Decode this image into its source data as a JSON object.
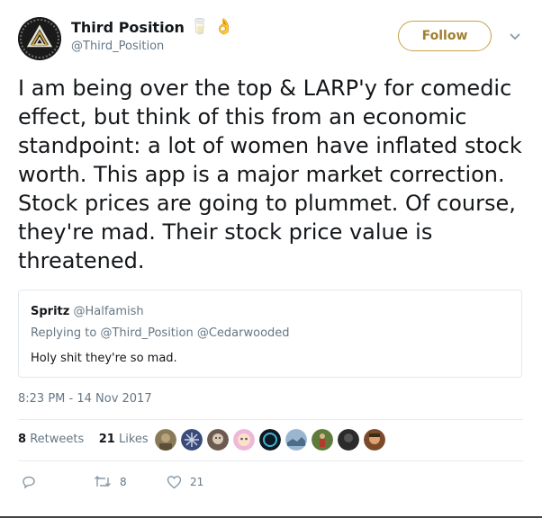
{
  "account": {
    "name": "Third Position",
    "handle": "@Third_Position",
    "emoji_1": "🥛",
    "emoji_2": "👌"
  },
  "follow_label": "Follow",
  "tweet_text": "I am being over the top & LARP'y for comedic effect, but think of this from an economic standpoint: a lot of women have inflated stock worth. This app is a major market correction. Stock prices are going to plummet. Of course, they're mad. Their stock price value is threatened.",
  "quoted": {
    "name": "Spritz",
    "handle": "@Halfamish",
    "replying_prefix": "Replying to",
    "replying_to": "@Third_Position @Cedarwooded",
    "text": "Holy shit they're so mad."
  },
  "timestamp": "8:23 PM - 14 Nov 2017",
  "stats": {
    "retweets_count": "8",
    "retweets_label": "Retweets",
    "likes_count": "21",
    "likes_label": "Likes"
  },
  "liker_avatars": [
    "avatar-1",
    "avatar-2",
    "avatar-3",
    "avatar-4",
    "avatar-5",
    "avatar-6",
    "avatar-7",
    "avatar-8",
    "avatar-9"
  ],
  "actions": {
    "reply_icon": "reply-icon",
    "retweet_icon": "retweet-icon",
    "retweet_count": "8",
    "like_icon": "heart-icon",
    "like_count": "21"
  },
  "colors": {
    "follow_accent": "#c6a24a",
    "text": "#14171a",
    "secondary": "#657786",
    "border": "#e1e8ed"
  }
}
